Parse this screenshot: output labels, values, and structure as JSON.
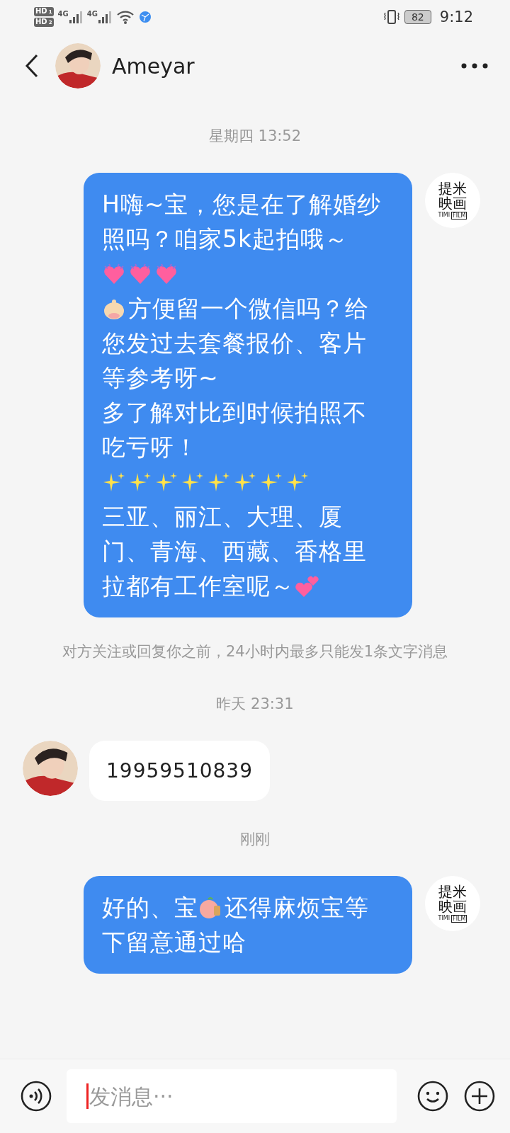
{
  "status_bar": {
    "sims": [
      {
        "label": "HD",
        "slot": "1"
      },
      {
        "label": "HD",
        "slot": "2"
      }
    ],
    "networks": [
      "4G",
      "4G"
    ],
    "battery": "82",
    "time": "9:12"
  },
  "header": {
    "title": "Ameyar"
  },
  "messages": [
    {
      "kind": "time",
      "text": "星期四 13:52"
    },
    {
      "kind": "outgoing",
      "avatar": {
        "line1": "提米",
        "line2": "映画",
        "tag": [
          "TIMI",
          "FILM"
        ]
      },
      "lines": [
        [
          {
            "kind": "text",
            "text": "H嗨~宝，您是在了解婚纱"
          }
        ],
        [
          {
            "kind": "text",
            "text": "照吗？咱家5k起拍哦～"
          }
        ],
        [
          {
            "kind": "heart"
          },
          {
            "kind": "heart"
          },
          {
            "kind": "heart"
          }
        ],
        [
          {
            "kind": "blob"
          },
          {
            "kind": "text",
            "text": "方便留一个微信吗？给"
          }
        ],
        [
          {
            "kind": "text",
            "text": "您发过去套餐报价、客片"
          }
        ],
        [
          {
            "kind": "text",
            "text": "等参考呀~"
          }
        ],
        [
          {
            "kind": "text",
            "text": "多了解对比到时候拍照不"
          }
        ],
        [
          {
            "kind": "text",
            "text": "吃亏呀！"
          }
        ],
        [
          {
            "kind": "sparkle"
          },
          {
            "kind": "sparkle"
          },
          {
            "kind": "sparkle"
          },
          {
            "kind": "sparkle"
          },
          {
            "kind": "sparkle"
          },
          {
            "kind": "sparkle"
          },
          {
            "kind": "sparkle"
          },
          {
            "kind": "sparkle"
          }
        ],
        [
          {
            "kind": "text",
            "text": "三亚、丽江、大理、厦"
          }
        ],
        [
          {
            "kind": "text",
            "text": "门、青海、西藏、香格里"
          }
        ],
        [
          {
            "kind": "text",
            "text": "拉都有工作室呢～"
          },
          {
            "kind": "hearts"
          }
        ]
      ]
    },
    {
      "kind": "notice",
      "text": "对方关注或回复你之前，24小时内最多只能发1条文字消息"
    },
    {
      "kind": "time",
      "text": "昨天 23:31"
    },
    {
      "kind": "incoming",
      "lines": [
        [
          {
            "kind": "text",
            "text": "19959510839"
          }
        ]
      ]
    },
    {
      "kind": "time",
      "text": "刚刚"
    },
    {
      "kind": "outgoing",
      "avatar": {
        "line1": "提米",
        "line2": "映画",
        "tag": [
          "TIMI",
          "FILM"
        ]
      },
      "lines": [
        [
          {
            "kind": "text",
            "text": "好的、宝"
          },
          {
            "kind": "peach"
          },
          {
            "kind": "text",
            "text": "还得麻烦宝等"
          }
        ],
        [
          {
            "kind": "text",
            "text": "下留意通过哈"
          }
        ]
      ]
    }
  ],
  "composer": {
    "placeholder": "发消息···"
  }
}
